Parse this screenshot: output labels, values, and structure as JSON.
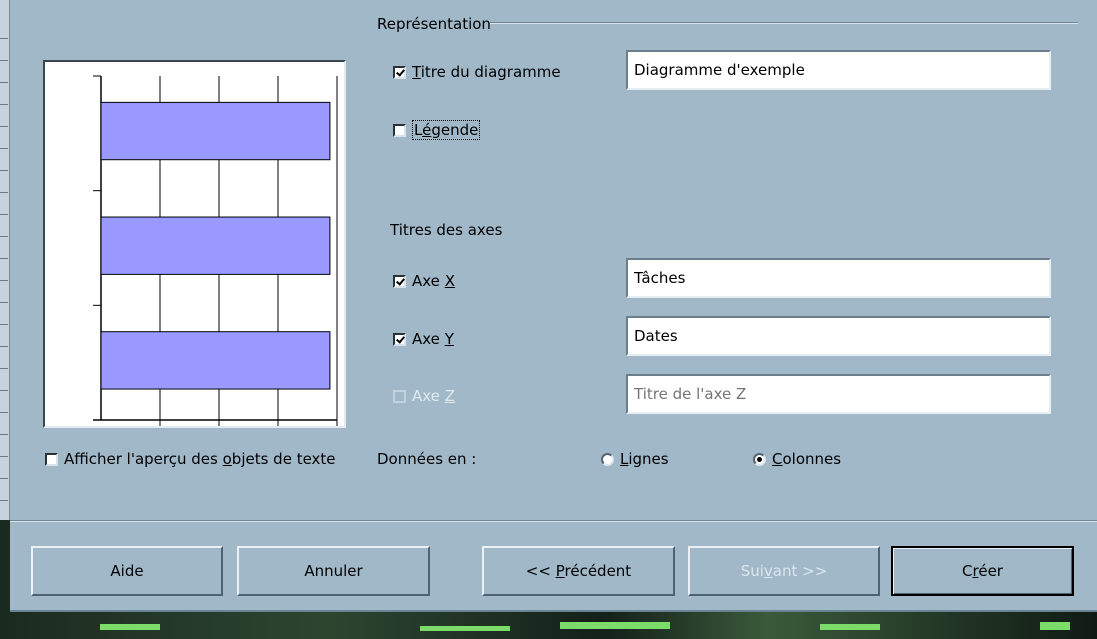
{
  "group": {
    "title": "Représentation"
  },
  "chart_title": {
    "label": "Titre du diagramme",
    "checked": true,
    "value": "Diagramme d'exemple"
  },
  "legend": {
    "label": "Légende",
    "checked": false
  },
  "axes": {
    "section_label": "Titres des axes",
    "x": {
      "label": "Axe X",
      "checked": true,
      "value": "Tâches"
    },
    "y": {
      "label": "Axe Y",
      "checked": true,
      "value": "Dates"
    },
    "z": {
      "label": "Axe Z",
      "checked": false,
      "disabled": true,
      "placeholder": "Titre de l'axe Z"
    }
  },
  "preview_option": {
    "label": "Afficher l'aperçu des objets de texte",
    "checked": false
  },
  "data_in": {
    "label": "Données en :",
    "options": [
      {
        "label": "Lignes",
        "selected": false
      },
      {
        "label": "Colonnes",
        "selected": true
      }
    ]
  },
  "buttons": {
    "help": "Aide",
    "cancel": "Annuler",
    "previous": "<< Précédent",
    "next": "Suivant >>",
    "create": "Créer"
  },
  "preview_chart": {
    "type": "bar",
    "orientation": "horizontal",
    "bar_color": "#9999ff",
    "bars": [
      0.97,
      0.97,
      0.97
    ]
  }
}
